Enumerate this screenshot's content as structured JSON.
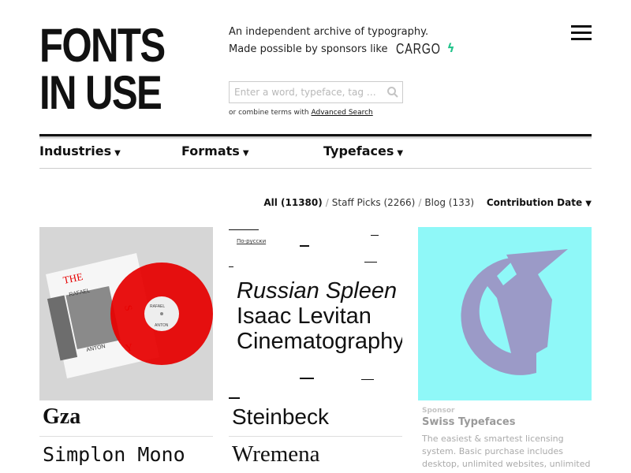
{
  "logo": {
    "line1": "FONTS",
    "line2": "IN USE"
  },
  "tagline": {
    "line1": "An independent archive of typography.",
    "line2": "Made possible by sponsors like",
    "sponsor_logo": "CARGO"
  },
  "search": {
    "placeholder": "Enter a word, typeface, tag …",
    "icon": "search-icon"
  },
  "combine": {
    "prefix": "or combine terms with",
    "link": "Advanced Search"
  },
  "nav": [
    {
      "label": "Industries"
    },
    {
      "label": "Formats"
    },
    {
      "label": "Typefaces"
    }
  ],
  "filters": {
    "all": "All (11380)",
    "staff_picks": "Staff Picks (2266)",
    "blog": "Blog (133)",
    "sort": "Contribution Date",
    "separator": "/"
  },
  "cards": [
    {
      "texts": [
        "THE",
        "RAFAEL",
        "ANTON",
        "RAFAEL",
        "ANTON",
        "Y"
      ],
      "font_names": [
        "Gza",
        "Simplon Mono"
      ]
    },
    {
      "link": "По-русски",
      "lines": [
        "Russian Spleen",
        "Isaac Levitan",
        "Cinematography"
      ],
      "font_names": [
        "Steinbeck",
        "Wremena"
      ]
    },
    {
      "sponsor_label": "Sponsor",
      "sponsor_name": "Swiss Typefaces",
      "sponsor_desc": "The easiest & smartest licensing system. Basic purchase includes desktop, unlimited websites, unlimited"
    }
  ],
  "colors": {
    "accent": "#23c38b",
    "record_red": "#e60000",
    "unicorn_bg": "#8ff8f8",
    "unicorn": "#9b9ac7"
  }
}
